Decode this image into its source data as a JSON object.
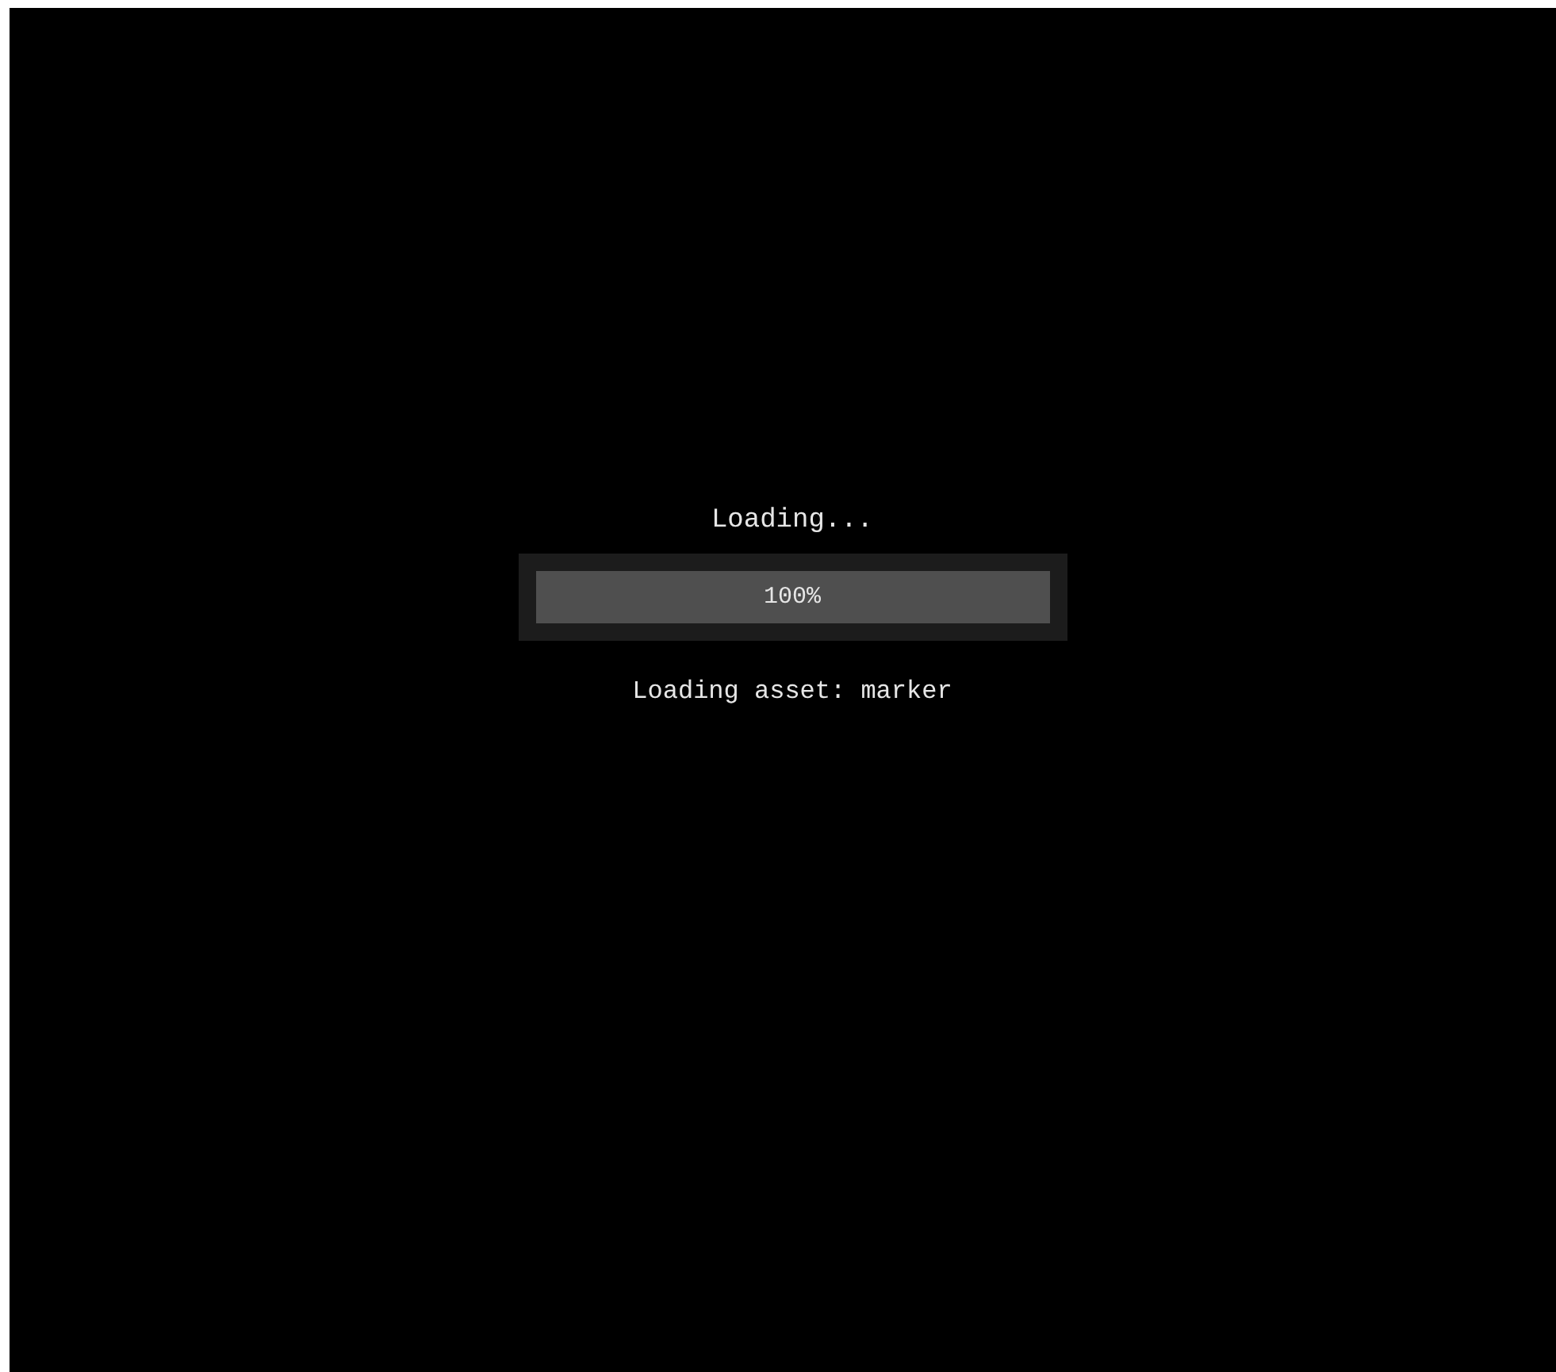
{
  "title": "Loading...",
  "progress": {
    "level": 1,
    "reading": "100%"
  },
  "status": "Loading asset: marker"
}
